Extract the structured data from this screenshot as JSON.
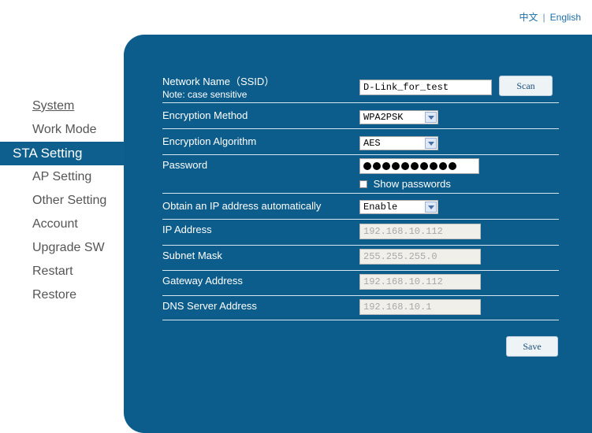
{
  "lang": {
    "chinese": "中文",
    "separator": "|",
    "english": "English"
  },
  "nav": {
    "system": "System",
    "work_mode": "Work Mode",
    "sta_setting": "STA Setting",
    "ap_setting": "AP Setting",
    "other_setting": "Other Setting",
    "account": "Account",
    "upgrade_sw": "Upgrade SW",
    "restart": "Restart",
    "restore": "Restore"
  },
  "form": {
    "ssid_label": "Network Name（SSID）",
    "ssid_note": "Note: case sensitive",
    "ssid_value": "D-Link_for_test",
    "scan_label": "Scan",
    "encryption_method_label": "Encryption Method",
    "encryption_method_value": "WPA2PSK",
    "encryption_algorithm_label": "Encryption Algorithm",
    "encryption_algorithm_value": "AES",
    "password_label": "Password",
    "password_length": 10,
    "show_passwords_label": "Show passwords",
    "show_passwords_checked": false,
    "dhcp_label": "Obtain an IP address automatically",
    "dhcp_value": "Enable",
    "ip_label": "IP Address",
    "ip_value": "192.168.10.112",
    "subnet_label": "Subnet Mask",
    "subnet_value": "255.255.255.0",
    "gateway_label": "Gateway Address",
    "gateway_value": "192.168.10.112",
    "dns_label": "DNS Server Address",
    "dns_value": "192.168.10.1",
    "save_label": "Save"
  },
  "colors": {
    "panel": "#0d5d8c",
    "active_nav": "#0e5f8e",
    "link": "#1d6fa8"
  }
}
